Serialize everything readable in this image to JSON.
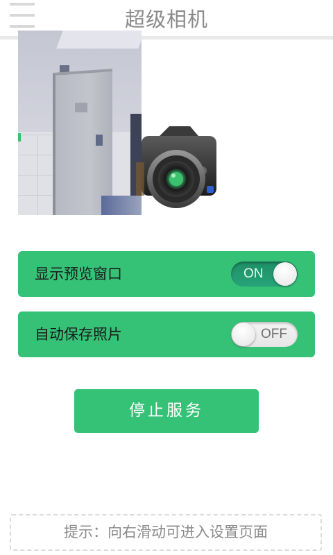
{
  "header": {
    "title": "超级相机",
    "menu_icon": "hamburger-menu-icon"
  },
  "preview": {
    "icon": "camera-icon"
  },
  "toggles": [
    {
      "label": "显示预览窗口",
      "state_text": "ON",
      "on": true
    },
    {
      "label": "自动保存照片",
      "state_text": "OFF",
      "on": false
    }
  ],
  "actions": {
    "stop_label": "停止服务"
  },
  "hint": {
    "text": "提示：向右滑动可进入设置页面"
  },
  "colors": {
    "accent_green": "#35c277",
    "switch_on": "#1e8f67",
    "title_gray": "#8a8a8a",
    "hint_gray": "#8b8b8b"
  }
}
